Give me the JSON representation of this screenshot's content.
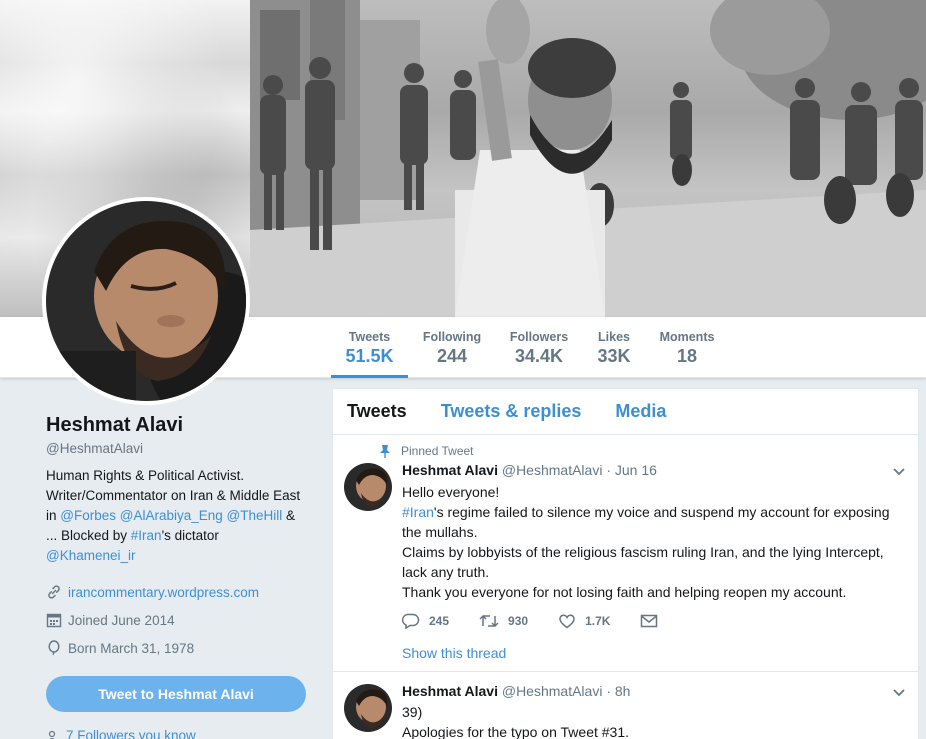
{
  "profile": {
    "name": "Heshmat Alavi",
    "handle": "@HeshmatAlavi",
    "bio_parts": {
      "p1": "Human Rights & Political Activist. Writer/Commentator on Iran & Middle East in ",
      "forbes": "@Forbes",
      "alarabiya": "@AlArabiya_Eng",
      "thehill": "@TheHill",
      "p2": " & ... Blocked by ",
      "iran": "#Iran",
      "p3": "'s dictator ",
      "khamenei": "@Khamenei_ir"
    },
    "website": "irancommentary.wordpress.com",
    "joined": "Joined June 2014",
    "born": "Born March 31, 1978",
    "tweet_to": "Tweet to Heshmat Alavi",
    "followers_you_know": "7 Followers you know"
  },
  "stats": [
    {
      "label": "Tweets",
      "value": "51.5K",
      "active": true
    },
    {
      "label": "Following",
      "value": "244"
    },
    {
      "label": "Followers",
      "value": "34.4K"
    },
    {
      "label": "Likes",
      "value": "33K"
    },
    {
      "label": "Moments",
      "value": "18"
    }
  ],
  "tabs": [
    "Tweets",
    "Tweets & replies",
    "Media"
  ],
  "tweets": [
    {
      "pinned_label": "Pinned Tweet",
      "name": "Heshmat Alavi",
      "handle": "@HeshmatAlavi",
      "time": "· Jun 16",
      "lines": {
        "l1": "Hello everyone!",
        "hashtag": "#Iran",
        "l2": "'s regime failed to silence my voice and suspend my account for exposing the mullahs.",
        "l3": "Claims by lobbyists of the religious fascism ruling Iran, and the lying Intercept, lack any truth.",
        "l4": "Thank you everyone for not losing faith and helping reopen my account."
      },
      "replies": "245",
      "retweets": "930",
      "likes": "1.7K",
      "show_thread": "Show this thread"
    },
    {
      "name": "Heshmat Alavi",
      "handle": "@HeshmatAlavi",
      "time": "· 8h",
      "lines": {
        "l1": "39)",
        "l2": "Apologies for the typo on Tweet #31."
      }
    }
  ],
  "colors": {
    "accent": "#3d8fd3",
    "button": "#6cb3ee",
    "muted": "#657786",
    "text": "#14171a",
    "background": "#e6ecf0"
  },
  "icons": [
    "link-icon",
    "calendar-icon",
    "balloon-icon",
    "pin-icon",
    "chevron-down-icon",
    "reply-icon",
    "retweet-icon",
    "heart-icon",
    "message-icon",
    "person-icon"
  ]
}
